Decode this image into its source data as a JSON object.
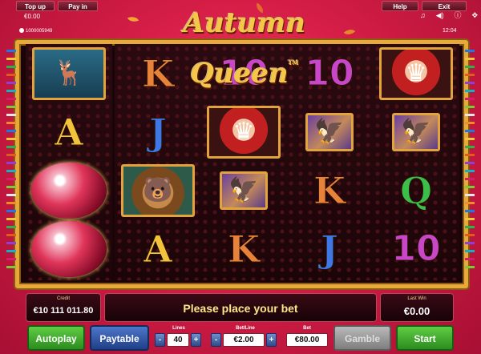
{
  "topbar": {
    "topup_label": "Top up",
    "payin_label": "Pay in",
    "help_label": "Help",
    "exit_label": "Exit",
    "balance": "€0.00",
    "session_id": "1000005949",
    "clock": "12:04"
  },
  "icons": [
    "music-note-icon",
    "sound-icon",
    "info-icon",
    "fullscreen-icon"
  ],
  "game": {
    "title": "Autumn Queen",
    "tm": "TM"
  },
  "reels": [
    [
      "stag",
      "A",
      "crystal-orb",
      "crystal-orb"
    ],
    [
      "K",
      "J",
      "bear",
      "A"
    ],
    [
      "10",
      "queen",
      "hawk",
      "K"
    ],
    [
      "10",
      "hawk",
      "K",
      "J"
    ],
    [
      "queen",
      "hawk",
      "Q",
      "10"
    ]
  ],
  "colors": {
    "background": "#d61e47",
    "frame_gold": "#e6a93a",
    "green_button": "#2b8c1e",
    "blue_button": "#203f88",
    "message_text": "#ffe58a"
  },
  "bottom": {
    "credit_label": "Credit",
    "credit_value": "€10 111 011.80",
    "message": "Please place your bet",
    "lastwin_label": "Last Win",
    "lastwin_value": "€0.00",
    "autoplay_label": "Autoplay",
    "paytable_label": "Paytable",
    "lines_label": "Lines",
    "lines_value": "40",
    "betline_label": "Bet/Line",
    "betline_value": "€2.00",
    "bet_label": "Bet",
    "bet_value": "€80.00",
    "gamble_label": "Gamble",
    "start_label": "Start",
    "minus": "-",
    "plus": "+"
  }
}
